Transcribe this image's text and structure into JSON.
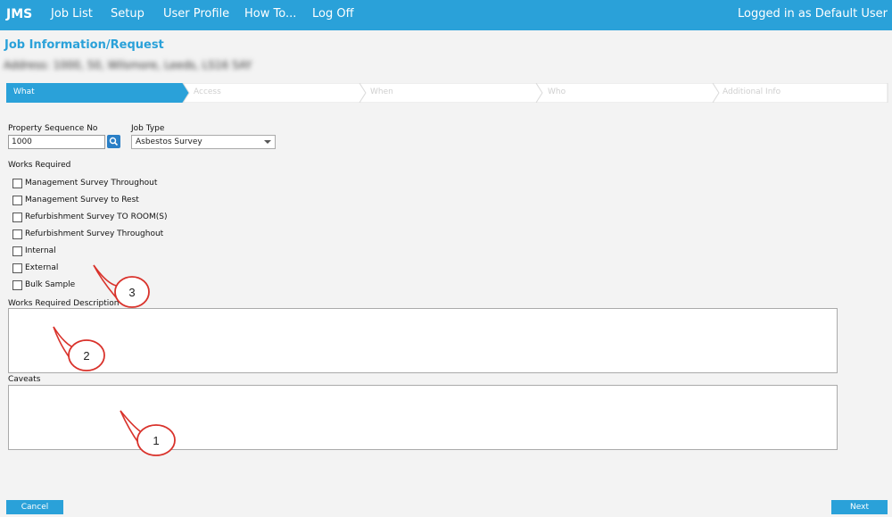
{
  "header": {
    "brand": "JMS",
    "nav": [
      "Job List",
      "Setup",
      "User Profile",
      "How To...",
      "Log Off"
    ],
    "logged_in": "Logged in as Default User"
  },
  "page": {
    "title": "Job Information/Request",
    "address": "Address: 1000, 50, Wilsmore, Leeds, LS16 5AY"
  },
  "wizard": {
    "steps": [
      "What",
      "Access",
      "When",
      "Who",
      "Additional Info"
    ],
    "active_step": "What"
  },
  "form": {
    "property_sequence_label": "Property Sequence No",
    "property_sequence_value": "1000",
    "job_type_label": "Job Type",
    "job_type_value": "Asbestos Survey",
    "works_required_label": "Works Required",
    "works_required_options": [
      "Management Survey Throughout",
      "Management Survey to Rest",
      "Refurbishment Survey TO ROOM(S)",
      "Refurbishment Survey Throughout",
      "Internal",
      "External",
      "Bulk Sample"
    ],
    "works_required_description_label": "Works Required Description",
    "caveats_label": "Caveats"
  },
  "buttons": {
    "cancel": "Cancel",
    "next": "Next"
  },
  "callouts": [
    "3",
    "2",
    "1"
  ],
  "colors": {
    "accent": "#2aa1d9",
    "callout_stroke": "#d9322b"
  }
}
